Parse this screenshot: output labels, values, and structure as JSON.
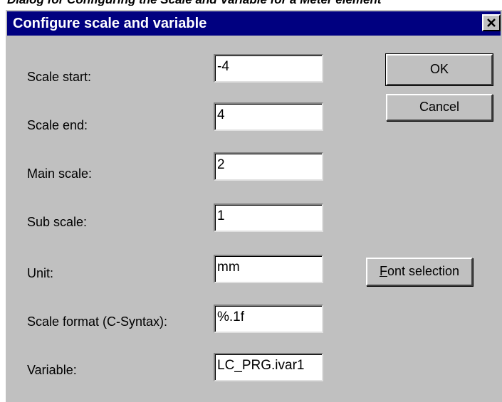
{
  "caption": "Dialog for Configuring the Scale and Variable for a Meter element",
  "dialog": {
    "title": "Configure scale and variable",
    "close_symbol": "close-icon"
  },
  "fields": [
    {
      "label": "Scale start:",
      "value": "-4"
    },
    {
      "label": "Scale end:",
      "value": "4"
    },
    {
      "label": "Main scale:",
      "value": "2"
    },
    {
      "label": "Sub scale:",
      "value": "1"
    },
    {
      "label": "Unit:",
      "value": "mm"
    },
    {
      "label": "Scale format (C-Syntax):",
      "value": "%.1f"
    },
    {
      "label": "Variable:",
      "value": "LC_PRG.ivar1"
    }
  ],
  "buttons": {
    "ok": "OK",
    "cancel": "Cancel",
    "font_selection_mnemonic": "F",
    "font_selection_rest": "ont selection"
  },
  "colors": {
    "dialog_bg": "#c0c0c0",
    "titlebar": "#000080"
  }
}
